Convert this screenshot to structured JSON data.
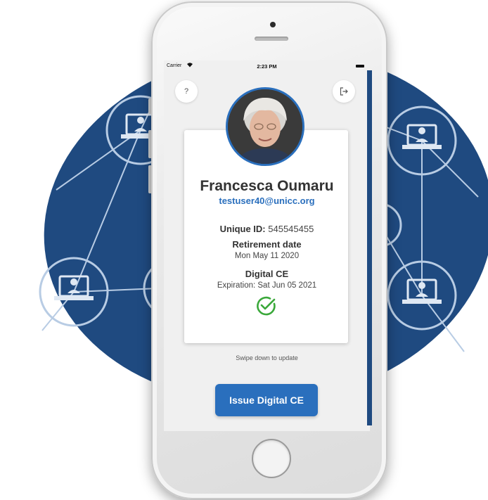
{
  "status_bar": {
    "carrier": "Carrier",
    "wifi_icon": "wifi-icon",
    "time": "2:23 PM",
    "battery_icon": "battery-icon"
  },
  "toolbar": {
    "help_label": "?",
    "logout_icon": "logout-icon"
  },
  "profile": {
    "name": "Francesca Oumaru",
    "email": "testuser40@unicc.org",
    "unique_id_label": "Unique ID:",
    "unique_id_value": "545545455",
    "retirement_label": "Retirement date",
    "retirement_value": "Mon May 11 2020",
    "ce_label": "Digital CE",
    "ce_expiration": "Expiration: Sat Jun 05 2021",
    "ce_status_icon": "check-circle-icon"
  },
  "hint": "Swipe down to update",
  "actions": {
    "issue_label": "Issue Digital CE"
  },
  "colors": {
    "accent": "#2a6fbd",
    "success": "#3aa83a",
    "background_blob": "#1f4a80"
  }
}
